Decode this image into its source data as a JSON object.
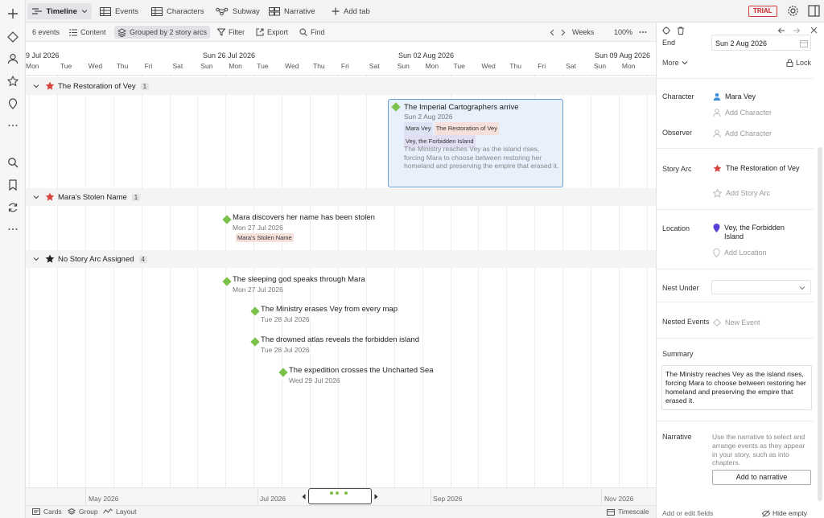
{
  "tabs": [
    {
      "label": "Timeline",
      "active": true
    },
    {
      "label": "Events"
    },
    {
      "label": "Characters"
    },
    {
      "label": "Subway"
    },
    {
      "label": "Narrative"
    },
    {
      "label": "Add tab"
    }
  ],
  "trial_badge": "TRIAL",
  "toolbar": {
    "event_count": "6 events",
    "content": "Content",
    "grouped": "Grouped by 2 story arcs",
    "filter": "Filter",
    "export": "Export",
    "find": "Find",
    "weeks": "Weeks",
    "zoom": "100%"
  },
  "weeks_header": [
    "9 Jul 2026",
    "Sun 26 Jul 2026",
    "Sun 02 Aug 2026",
    "Sun 09 Aug 2026"
  ],
  "days": [
    "Mon",
    "Tue",
    "Wed",
    "Thu",
    "Fri",
    "Sat",
    "Sun",
    "Mon",
    "Tue",
    "Wed",
    "Thu",
    "Fri",
    "Sat",
    "Sun",
    "Mon",
    "Tue",
    "Wed",
    "Thu",
    "Fri",
    "Sat",
    "Sun",
    "Mon"
  ],
  "groups": [
    {
      "name": "The Restoration of Vey",
      "count": "1",
      "star": "#d8453c"
    },
    {
      "name": "Mara's Stolen Name",
      "count": "1",
      "star": "#d8453c"
    },
    {
      "name": "No Story Arc Assigned",
      "count": "4",
      "star": "#222222"
    }
  ],
  "selected_event": {
    "title": "The Imperial Cartographers arrive",
    "date": "Sun 2 Aug 2026",
    "tags": [
      "Mara Vey",
      "The Restoration of Vey",
      "Vey, the Forbidden Island"
    ],
    "summary": "The Ministry reaches Vey as the island rises, forcing Mara to choose between restoring her homeland and preserving the empire that erased it."
  },
  "events": [
    {
      "title": "Mara discovers her name has been stolen",
      "date": "Mon 27 Jul 2026",
      "tag": "Mara's Stolen Name"
    },
    {
      "title": "The sleeping god speaks through Mara",
      "date": "Mon 27 Jul 2026"
    },
    {
      "title": "The Ministry erases Vey from every map",
      "date": "Tue 28 Jul 2026"
    },
    {
      "title": "The drowned atlas reveals the forbidden island",
      "date": "Tue 28 Jul 2026"
    },
    {
      "title": "The expedition crosses the Uncharted Sea",
      "date": "Wed 29 Jul 2026"
    }
  ],
  "mini_timeline": [
    "May 2026",
    "Jul 2026",
    "Sep 2026",
    "Nov 2026"
  ],
  "bottom": {
    "cards": "Cards",
    "group": "Group",
    "layout": "Layout",
    "timescale": "Timescale"
  },
  "panel": {
    "end_label": "End",
    "end_value": "Sun 2 Aug 2026",
    "more": "More",
    "lock": "Lock",
    "character_label": "Character",
    "character_value": "Mara Vey",
    "add_character": "Add Character",
    "observer_label": "Observer",
    "add_observer": "Add Character",
    "story_arc_label": "Story Arc",
    "story_arc_value": "The Restoration of Vey",
    "add_story_arc": "Add Story Arc",
    "location_label": "Location",
    "location_value": "Vey, the Forbidden Island",
    "add_location": "Add Location",
    "nest_label": "Nest Under",
    "nested_label": "Nested Events",
    "new_event": "New Event",
    "summary_label": "Summary",
    "summary_text": "The Ministry reaches Vey as the island rises, forcing Mara to choose between restoring her homeland and preserving the empire that erased it.",
    "narrative_label": "Narrative",
    "narrative_help": "Use the narrative to select and arrange events as they appear in your story, such as into chapters.",
    "add_narrative": "Add to narrative",
    "add_fields": "Add or edit fields",
    "hide_empty": "Hide empty"
  },
  "colors": {
    "accent": "#6f9fdb",
    "event_diamond": "#7cc14a",
    "arc_star": "#d8453c",
    "location_pin": "#5a3fd6",
    "character_icon": "#3f8fd6"
  }
}
